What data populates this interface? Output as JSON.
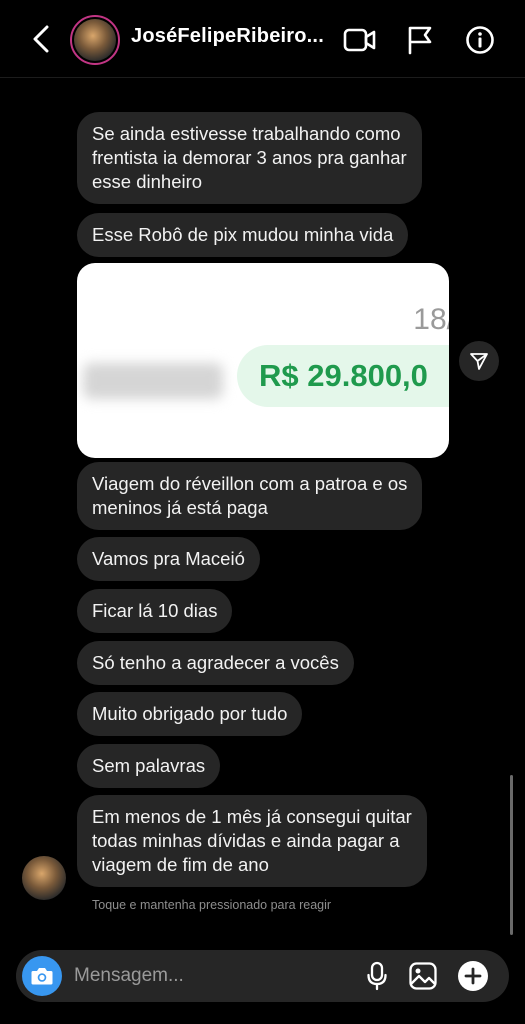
{
  "header": {
    "username": "JoséFelipeRibeiro...",
    "icons": [
      "chevron-left-icon",
      "video-camera-icon",
      "flag-icon",
      "info-icon"
    ]
  },
  "messages": [
    {
      "lines": [
        "Se ainda estivesse trabalhando como",
        "frentista ia demorar 3 anos pra ganhar",
        "esse dinheiro"
      ]
    },
    {
      "lines": [
        "Esse Robô de pix mudou minha vida"
      ]
    },
    {
      "lines": [
        "Viagem do réveillon com a patroa e os",
        "meninos já está paga"
      ]
    },
    {
      "lines": [
        "Vamos pra Maceió"
      ]
    },
    {
      "lines": [
        "Ficar lá 10 dias"
      ]
    },
    {
      "lines": [
        "Só tenho a agradecer a vocês"
      ]
    },
    {
      "lines": [
        "Muito obrigado por tudo"
      ]
    },
    {
      "lines": [
        "Sem palavras"
      ]
    },
    {
      "lines": [
        "Em menos de 1 mês já consegui quitar",
        "todas minhas dívidas e ainda pagar a",
        "viagem de fim de ano"
      ]
    }
  ],
  "image_message": {
    "amount": "R$ 29.800,0",
    "partial_number": "18/"
  },
  "reaction_hint": "Toque e mantenha pressionado para reagir",
  "composer": {
    "placeholder": "Mensagem...",
    "icons": [
      "camera-icon",
      "microphone-icon",
      "gallery-icon",
      "plus-icon"
    ]
  },
  "colors": {
    "background": "#000000",
    "bubble": "#262626",
    "accent": "#3897f0",
    "amount_green": "#1f9a4d"
  }
}
